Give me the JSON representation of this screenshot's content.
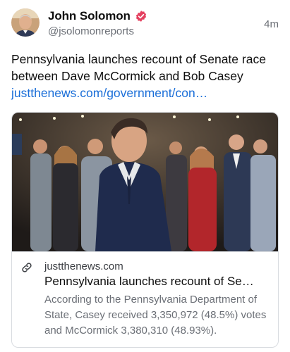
{
  "post": {
    "author_name": "John Solomon",
    "author_handle": "@jsolomonreports",
    "timestamp": "4m",
    "text": "Pennsylvania launches recount of Senate race between Dave McCormick and Bob Casey ",
    "link_text": "justthenews.com/government/con…",
    "verified_icon": "verified-badge-icon"
  },
  "link_card": {
    "domain": "justthenews.com",
    "title": "Pennsylvania launches recount of Se…",
    "description": "According to the Pennsylvania Department of State, Casey received 3,350,972 (48.5%) votes and McCormick 3,380,310 (48.93%).",
    "icon": "link-icon"
  },
  "colors": {
    "link": "#1a6ed8",
    "secondary_text": "#6b6f76",
    "verified": "#e4405f"
  }
}
